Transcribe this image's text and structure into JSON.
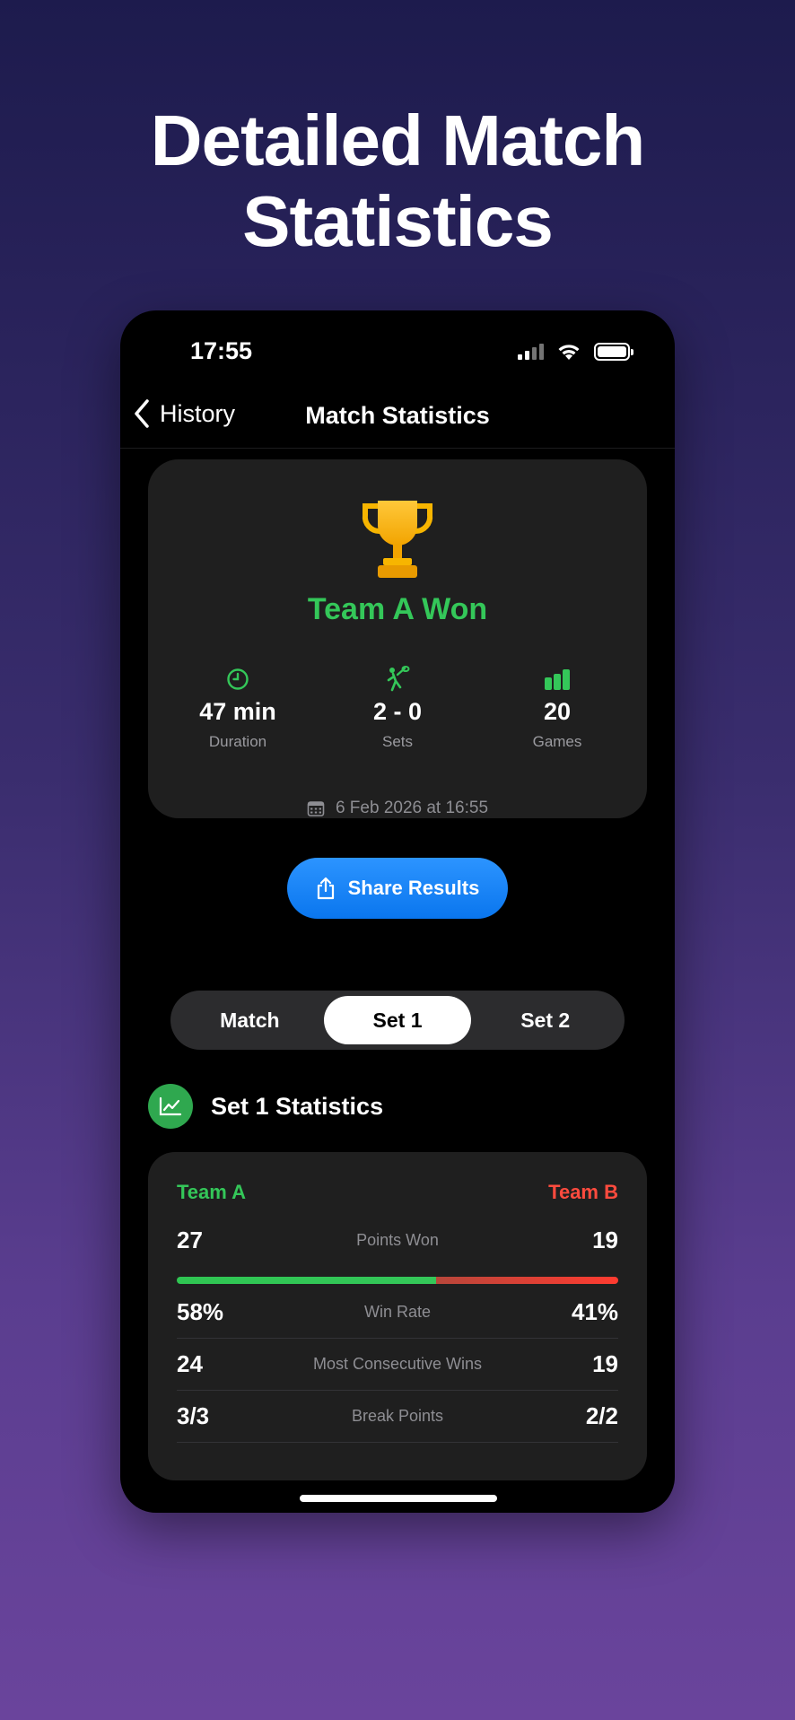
{
  "headline": {
    "line1": "Detailed Match",
    "line2": "Statistics"
  },
  "status_bar": {
    "time": "17:55",
    "icons": [
      "cellular-icon",
      "wifi-icon",
      "battery-icon"
    ]
  },
  "nav": {
    "back_label": "History",
    "title": "Match Statistics"
  },
  "summary": {
    "icon": "trophy-icon",
    "winner_text": "Team A Won",
    "stats": [
      {
        "icon": "clock-icon",
        "value": "47 min",
        "label": "Duration"
      },
      {
        "icon": "tennis-player-icon",
        "value": "2 - 0",
        "label": "Sets"
      },
      {
        "icon": "bar-chart-icon",
        "value": "20",
        "label": "Games"
      }
    ],
    "date": "6 Feb 2026 at 16:55",
    "share_label": "Share Results"
  },
  "segments": {
    "items": [
      "Match",
      "Set 1",
      "Set 2"
    ],
    "selected": "Set 1"
  },
  "section": {
    "title": "Set 1 Statistics"
  },
  "stats_card": {
    "team_a": "Team A",
    "team_b": "Team B",
    "points_share_a": 0.587,
    "rows": [
      {
        "left": "27",
        "label": "Points Won",
        "right": "19"
      },
      {
        "left": "58%",
        "label": "Win Rate",
        "right": "41%"
      },
      {
        "left": "24",
        "label": "Most Consecutive Wins",
        "right": "19"
      },
      {
        "left": "3/3",
        "label": "Break Points",
        "right": "2/2"
      }
    ]
  },
  "colors": {
    "team_a": "#34c759",
    "team_b": "#ff4b3e",
    "accent_blue": "#0a84ff",
    "trophy": "#f7b500"
  }
}
